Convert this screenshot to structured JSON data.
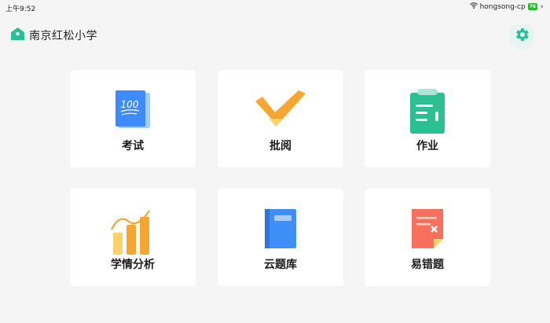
{
  "status_bar": {
    "time": "上午9:52",
    "network": "hongsong-cp",
    "battery": "76"
  },
  "header": {
    "school_name": "南京红松小学"
  },
  "colors": {
    "accent": "#2bbf99",
    "exam_blue": "#3d8bff",
    "review_orange": "#f7a531",
    "homework_green": "#2cbf94",
    "analysis_orange": "#f7a531",
    "bank_blue": "#3f8ef7",
    "mistakes_red": "#f86f5b"
  },
  "tiles": [
    {
      "label": "考试",
      "icon": "exam-paper-icon"
    },
    {
      "label": "批阅",
      "icon": "checkmark-icon"
    },
    {
      "label": "作业",
      "icon": "clipboard-icon"
    },
    {
      "label": "学情分析",
      "icon": "bar-chart-icon"
    },
    {
      "label": "云题库",
      "icon": "book-icon"
    },
    {
      "label": "易错题",
      "icon": "error-note-icon"
    }
  ],
  "exam_icon_text": "100"
}
